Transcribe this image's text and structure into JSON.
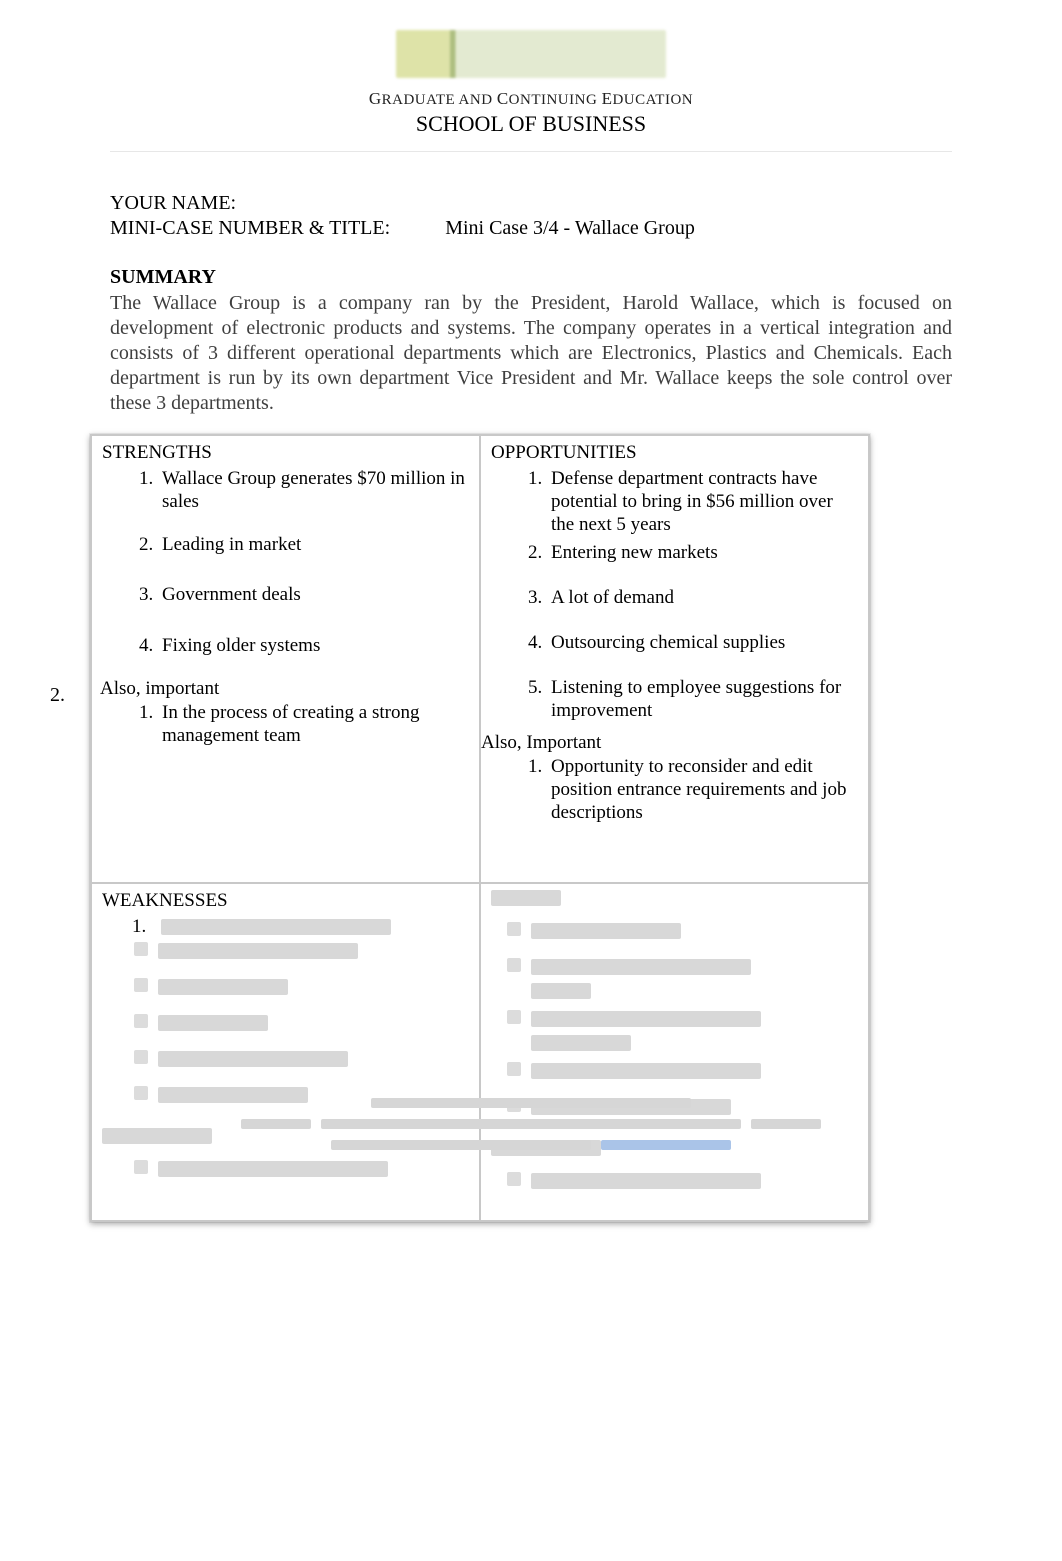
{
  "header": {
    "subline1_parts": [
      "G",
      "RADUATE AND ",
      "C",
      "ONTINUING ",
      "E",
      "DUCATION"
    ],
    "subline2": "SCHOOL OF BUSINESS"
  },
  "meta": {
    "name_label": "YOUR NAME:",
    "case_label": "MINI-CASE NUMBER & TITLE:",
    "case_value": "Mini Case 3/4 - Wallace Group"
  },
  "summary": {
    "title": "SUMMARY",
    "text": "The Wallace Group is a company ran by the President, Harold Wallace, which is focused on development of electronic products and systems. The company operates in a vertical integration and consists of 3 different operational departments which are Electronics, Plastics and Chemicals. Each department is run by its own department Vice President and Mr. Wallace keeps the sole control over these 3 departments."
  },
  "stray_number": "2.",
  "swot": {
    "strengths": {
      "title": "STRENGTHS",
      "items": [
        "Wallace Group generates $70 million in sales",
        "Leading in market",
        "Government deals",
        "Fixing older systems"
      ],
      "also_label": "Also, important",
      "also_items": [
        "In the process of creating a strong management team"
      ]
    },
    "opportunities": {
      "title": "OPPORTUNITIES",
      "items": [
        "Defense department contracts have potential to bring in $56 million over the next 5 years",
        "Entering new markets",
        "A lot of demand",
        "Outsourcing chemical supplies",
        "Listening to employee suggestions for improvement"
      ],
      "also_label": "Also, Important",
      "also_items": [
        "Opportunity to reconsider and edit position entrance requirements and job descriptions"
      ]
    },
    "weaknesses": {
      "title": "WEAKNESSES",
      "first_marker": "1."
    },
    "threats": {
      "title": ""
    }
  }
}
